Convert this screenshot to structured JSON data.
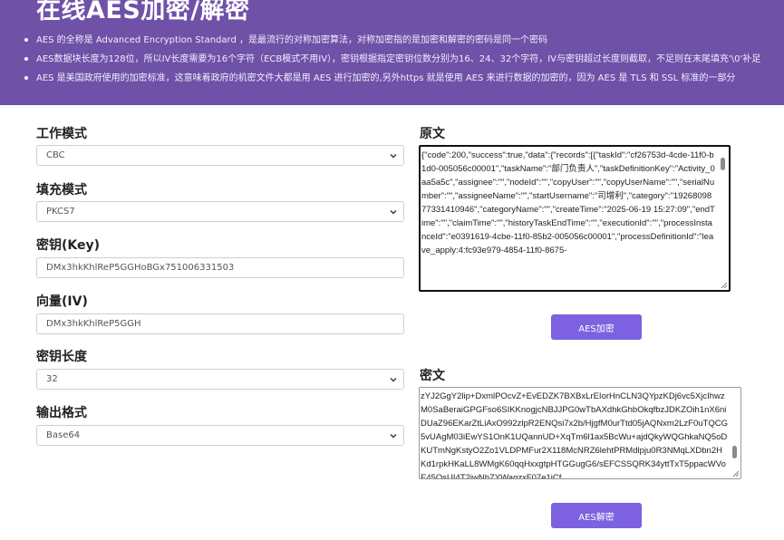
{
  "header": {
    "title": "在线AES加密/解密",
    "bullets": [
      "AES 的全称是 Advanced Encryption Standard ，是最流行的对称加密算法，对称加密指的是加密和解密的密码是同一个密码",
      "AES数据块长度为128位，所以IV长度需要为16个字符（ECB模式不用IV），密钥根据指定密钥位数分别为16、24、32个字符，IV与密钥超过长度则截取，不足则在末尾填充'\\0'补足",
      "AES 是美国政府使用的加密标准，这意味着政府的机密文件大都是用 AES 进行加密的,另外https 就是使用 AES 来进行数据的加密的，因为 AES 是 TLS 和 SSL 标准的一部分"
    ]
  },
  "form": {
    "mode_label": "工作模式",
    "mode_value": "CBC",
    "padding_label": "填充模式",
    "padding_value": "PKCS7",
    "key_label": "密钥(Key)",
    "key_value": "DMx3hkKhlReP5GGHoBGx751006331503",
    "iv_label": "向量(IV)",
    "iv_value": "DMx3hkKhlReP5GGH",
    "keylen_label": "密钥长度",
    "keylen_value": "32",
    "output_label": "输出格式",
    "output_value": "Base64"
  },
  "plaintext": {
    "label": "原文",
    "value": "{\"code\":200,\"success\":true,\"data\":{\"records\":[{\"taskId\":\"cf26753d-4cde-11f0-b1d0-005056c00001\",\"taskName\":\"部门负责人\",\"taskDefinitionKey\":\"Activity_0aa5a5c\",\"assignee\":\"\",\"nodeId\":\"\",\"copyUser\":\"\",\"copyUserName\":\"\",\"serialNumber\":\"\",\"assigneeName\":\"\",\"startUsername\":\"司增利\",\"category\":\"1926809877331410946\",\"categoryName\":\"\",\"createTime\":\"2025-06-19 15:27:09\",\"endTime\":\"\",\"claimTime\":\"\",\"historyTaskEndTime\":\"\",\"executionId\":\"\",\"processInstanceId\":\"e0391619-4cbe-11f0-85b2-005056c00001\",\"processDefinitionId\":\"leave_apply:4:fc93e979-4854-11f0-8675-",
    "encrypt_button": "AES加密"
  },
  "ciphertext": {
    "label": "密文",
    "value": "zYJ2GgY2lip+DxmlPOcvZ+EvEDZK7BXBxLrEIorHnCLN3QYpzKDj6vc5XjcIhwzM0SaBeraiGPGFso6SIKKnogjcNBJJPG0wTbAXdhkGhbOkqfbzJDKZOih1nX6niDUaZ96EKarZtLiAxO992zlpR2ENQsi7x2b/HjgfM0urTtd05jAQNxm2LzF0uTQCG5vUAgM03iEwYS1OnK1UQannUD+XqTm6l1ax5BcWu+ajdQkyWQGhkaNQ5oDKUTmNgKstyO2Zo1VLDPMFur2X118McNRZ6lehtPRMdlpju0R3NMqLXDbn2HKd1rpkHKaLL8WMgK60qqHxxgtpHTGGugG6/sEFCSSQRK34yttTxT5ppacWVoE45OsUI4T2jwNhZYWagzxF07e1jCf",
    "decrypt_button": "AES解密"
  },
  "colors": {
    "banner": "#6f51a8",
    "button": "#7c61e0"
  }
}
